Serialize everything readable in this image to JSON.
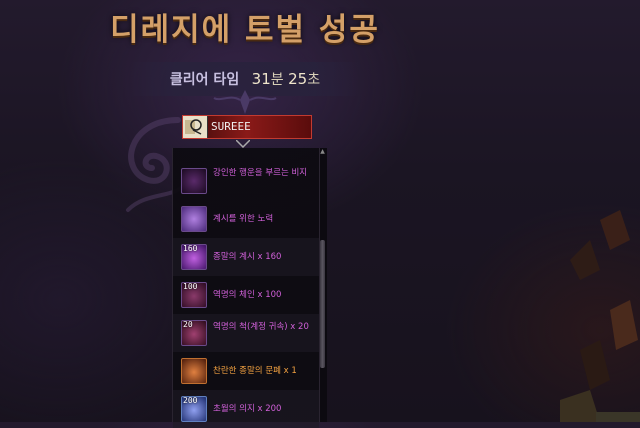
{
  "header": {
    "title": "디레지에 토벌 성공",
    "clear_label": "클리어 타임",
    "minutes": "31",
    "minutes_unit": "분",
    "seconds": "25",
    "seconds_unit": "초"
  },
  "player": {
    "name": "SUREEE"
  },
  "rewards": [
    {
      "name": "강인한 행운을 부르는 비지",
      "count": "",
      "color": "#d060d8"
    },
    {
      "name": "계시를 위한 노력",
      "count": "",
      "color": "#d060d8"
    },
    {
      "name": "종말의 계시 x 160",
      "count": "160",
      "color": "#d060d8"
    },
    {
      "name": "역명의 체인 x 100",
      "count": "100",
      "color": "#d060d8"
    },
    {
      "name": "역명의 척(계정 귀속) x 20",
      "count": "20",
      "color": "#d060d8"
    },
    {
      "name": "찬란한 종말의 문폐 x 1",
      "count": "",
      "color": "#f0a040"
    },
    {
      "name": "초월의 의지 x 200",
      "count": "200",
      "color": "#d060d8"
    }
  ],
  "colors": {
    "title": "#d4a068",
    "epic": "#d060d8",
    "legendary": "#f0a040",
    "player_bar": "#8a1a18"
  },
  "icons": {
    "player": "helmet-icon",
    "scroll_up": "arrow-up-icon"
  }
}
